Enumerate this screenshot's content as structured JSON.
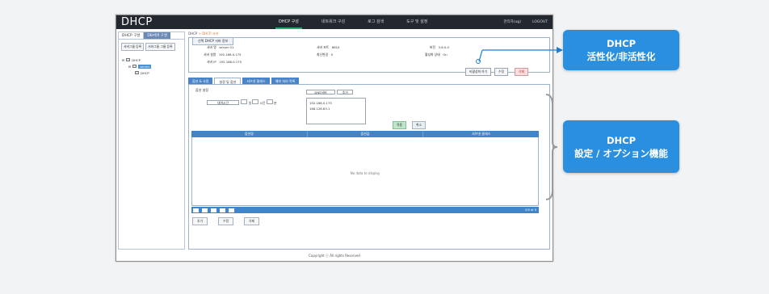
{
  "app": {
    "title": "DHCP"
  },
  "nav": [
    "DHCP 구성",
    "네트워크 구성",
    "로그 검색",
    "도구 및 설정"
  ],
  "top_right": [
    "관리자(ug)",
    "LOGOUT"
  ],
  "left_panel": {
    "tabs": [
      "DHCP 구성",
      "DB서버 구성"
    ],
    "buttons": [
      "서버그룹 등록",
      "서버그룹 그룹 등록"
    ],
    "tree": [
      "DHCP",
      "server",
      "DHCP"
    ]
  },
  "breadcrumb": {
    "root": "DHCP",
    "current": "DHCP 서버"
  },
  "server_info": {
    "tab": "선택 DHCP 서버 정보",
    "fields": [
      {
        "label": "서버 명",
        "value": "server 01"
      },
      {
        "label": "서버 포트",
        "value": "8810"
      },
      {
        "label": "버전",
        "value": "3.6.0.0"
      },
      {
        "label": "서버 설명",
        "value": "192.168.0.175"
      },
      {
        "label": "최신변경",
        "value": "0"
      },
      {
        "label": "활성화 상태",
        "value": "On"
      },
      {
        "label": "서버 IP",
        "value": "192.168.0.175"
      }
    ],
    "buttons": {
      "activate": "비활성화 하기",
      "edit": "수정",
      "delete": "삭제"
    }
  },
  "tabs": [
    "옵션 & 사용",
    "설정 및 옵션",
    "서브넷 클래스",
    "예외 처리 목록"
  ],
  "settings": {
    "section": "옵션 설정",
    "lease_label": "대여시간",
    "lease_units": [
      "일",
      "시간",
      "분"
    ],
    "dns_label": "DNS서버",
    "dns_button": "추가",
    "dns_list": [
      "192.168.0.175",
      "168.126.63.1"
    ],
    "apply": "적용",
    "cancel": "취소"
  },
  "table": {
    "headers": [
      "옵션명",
      "옵션값",
      "서브넷 클래스"
    ],
    "empty": "No data to display",
    "page_info": "0/0 of 0"
  },
  "bottom_buttons": [
    "추가",
    "수정",
    "삭제"
  ],
  "footer": "Copyright ⓒ All rights Reserved",
  "callouts": {
    "c1": [
      "DHCP",
      "活性化/非活性化"
    ],
    "c2": [
      "DHCP",
      "設定 / オプション機能"
    ]
  },
  "colors": {
    "accent": "#2b8fe0",
    "header": "#23272f",
    "table_header": "#3f85c9"
  }
}
